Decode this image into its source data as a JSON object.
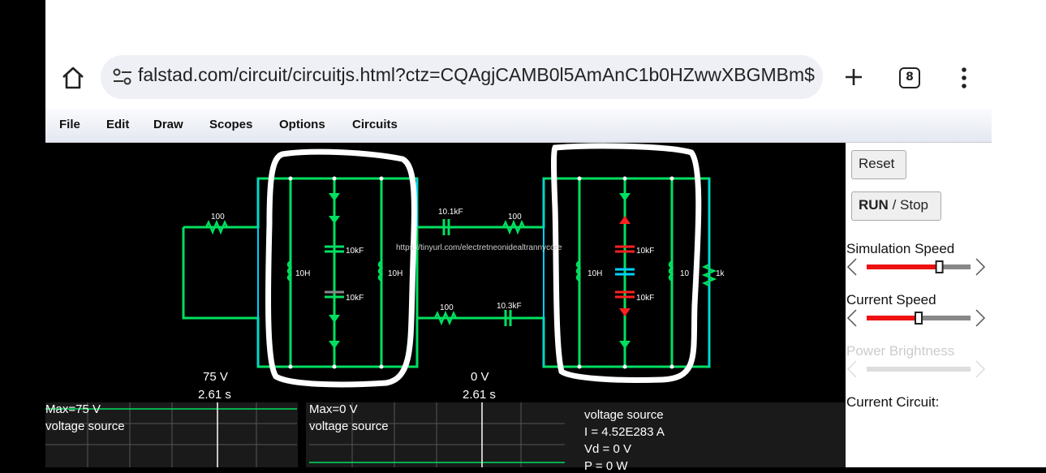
{
  "browser": {
    "url": "falstad.com/circuit/circuitjs.html?ctz=CQAgjCAMB0l5AmAnC1b0HZwwXBGMBm$",
    "tab_count": "8",
    "icons": [
      "home-icon",
      "site-settings-icon",
      "plus-icon",
      "tabs-icon",
      "kebab-menu-icon"
    ]
  },
  "menu": {
    "items": [
      "File",
      "Edit",
      "Draw",
      "Scopes",
      "Options",
      "Circuits"
    ]
  },
  "circuit": {
    "labels": {
      "r_left": "100",
      "cap_top_mid": "10.1kF",
      "r_top_mid": "100",
      "r_bottom_mid": "100",
      "cap_bottom_mid": "10.3kF",
      "left_cap1": "10kF",
      "left_cap2": "10kF",
      "left_ind1": "10H",
      "left_ind2": "10H",
      "right_cap1": "10kF",
      "right_cap2": "10kF",
      "right_ind1": "10H",
      "right_ind2": "10",
      "r_right": "1k",
      "url_text": "https://tinyurl.com/electretneonidealtrannycore",
      "left_voltage": "75 V",
      "left_time": "2.61 s",
      "mid_voltage": "0 V",
      "mid_time": "2.61 s"
    },
    "colors": {
      "wire": "#00e060",
      "wire_alt": "#00d0ff",
      "red": "#ff2020",
      "annotation": "#ffffff"
    }
  },
  "sidebar": {
    "reset_label": "Reset",
    "run_label": "RUN",
    "stop_label": "/ Stop",
    "sim_speed_label": "Simulation Speed",
    "sim_speed_value": 0.7,
    "current_speed_label": "Current Speed",
    "current_speed_value": 0.5,
    "power_brightness_label": "Power Brightness",
    "current_circuit_label": "Current Circuit:"
  },
  "scopes": [
    {
      "max": "Max=75 V",
      "name": "voltage source"
    },
    {
      "max": "Max=0 V",
      "name": "voltage source"
    }
  ],
  "info": {
    "title": "voltage source",
    "current": "I = 4.52E283 A",
    "vd": "Vd = 0 V",
    "p": "P = 0 W"
  }
}
